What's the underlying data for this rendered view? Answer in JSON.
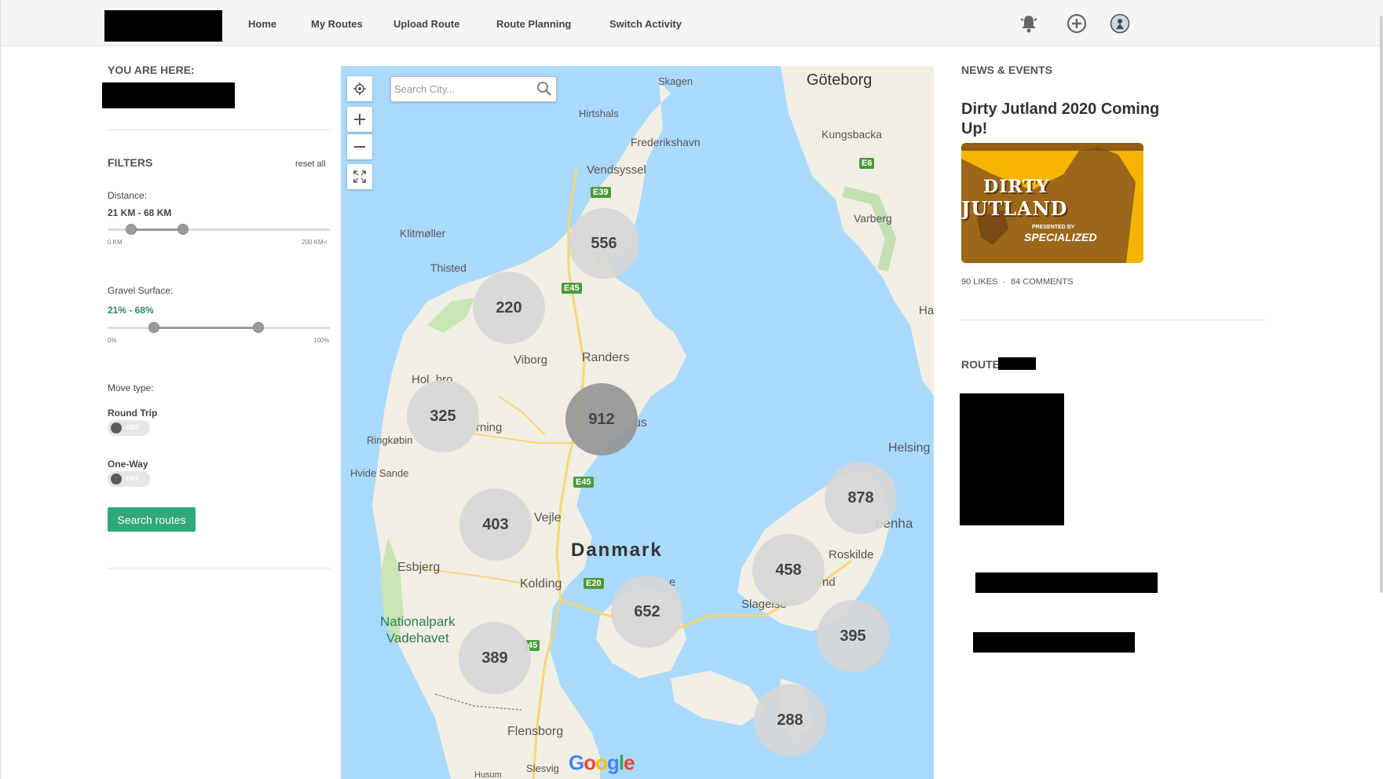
{
  "nav": {
    "items": [
      {
        "label": "Home"
      },
      {
        "label": "My Routes"
      },
      {
        "label": "Upload Route"
      },
      {
        "label": "Route Planning"
      },
      {
        "label": "Switch Activity"
      }
    ],
    "icons": [
      "bell-icon",
      "plus-circle-icon",
      "avatar-icon"
    ]
  },
  "sidebar": {
    "you_are_here": "YOU ARE HERE:",
    "filters_title": "FILTERS",
    "reset_label": "reset all",
    "distance": {
      "label": "Distance:",
      "value": "21 KM - 68 KM",
      "min_label": "0 KM",
      "max_label": "200 KM<",
      "low": 21,
      "high": 68,
      "max": 200
    },
    "gravel": {
      "label": "Gravel Surface:",
      "value": "21% - 68%",
      "min_label": "0%",
      "max_label": "100%",
      "low": 21,
      "high": 68,
      "max": 100
    },
    "move_type_label": "Move type:",
    "round_trip": {
      "label": "Round Trip",
      "state": "OFF"
    },
    "one_way": {
      "label": "One-Way",
      "state": "OFF"
    },
    "search_button": "Search routes"
  },
  "map": {
    "search_placeholder": "Search City...",
    "country_label": "Danmark",
    "clusters": [
      {
        "count": "556"
      },
      {
        "count": "220"
      },
      {
        "count": "325"
      },
      {
        "count": "912"
      },
      {
        "count": "403"
      },
      {
        "count": "652"
      },
      {
        "count": "389"
      },
      {
        "count": "878"
      },
      {
        "count": "458"
      },
      {
        "count": "395"
      },
      {
        "count": "288"
      }
    ],
    "places": {
      "goteborg": "Göteborg",
      "kungsbacka": "Kungsbacka",
      "varberg": "Varberg",
      "skagen": "Skagen",
      "hirtshals": "Hirtshals",
      "frederikshavn": "Frederikshavn",
      "vendsyssel": "Vendsyssel",
      "klitmoller": "Klitmøller",
      "thisted": "Thisted",
      "viborg": "Viborg",
      "randers": "Randers",
      "holstebro": "Hol  bro",
      "herning": "rning",
      "ringkobing": "Ringkøbin",
      "hvide_sande": "Hvide Sande",
      "aarhus": "us",
      "vejle": "Vejle",
      "esbjerg": "Esbjerg",
      "kolding": "Kolding",
      "nationalpark": "Nationalpark",
      "vadehavet": "Vadehavet",
      "flensborg": "Flensborg",
      "slesvig": "Slesvig",
      "husum": "Husum",
      "helsingor": "Helsing",
      "kobenhavn": "benha",
      "roskilde": "Roskilde",
      "slagelse": "Slagelse",
      "ha": "Ha",
      "nd": "nd",
      "e_mark": "e"
    },
    "roads": {
      "e39": "E39",
      "e45_north": "E45",
      "e45_south": "E45",
      "e20": "E20",
      "e45_frag": "45",
      "e6": "E6"
    },
    "attribution": "Google"
  },
  "right": {
    "news_title": "NEWS & EVENTS",
    "article_title": "Dirty Jutland 2020 Coming Up!",
    "image_text_line1": "DIRTY",
    "image_text_line2": "JUTLAND",
    "image_presented": "PRESENTED BY",
    "image_sponsor": "SPECIALIZED",
    "likes": "90 LIKES",
    "separator": "·",
    "comments": "84 COMMENTS",
    "routes_title": "ROUTE"
  }
}
